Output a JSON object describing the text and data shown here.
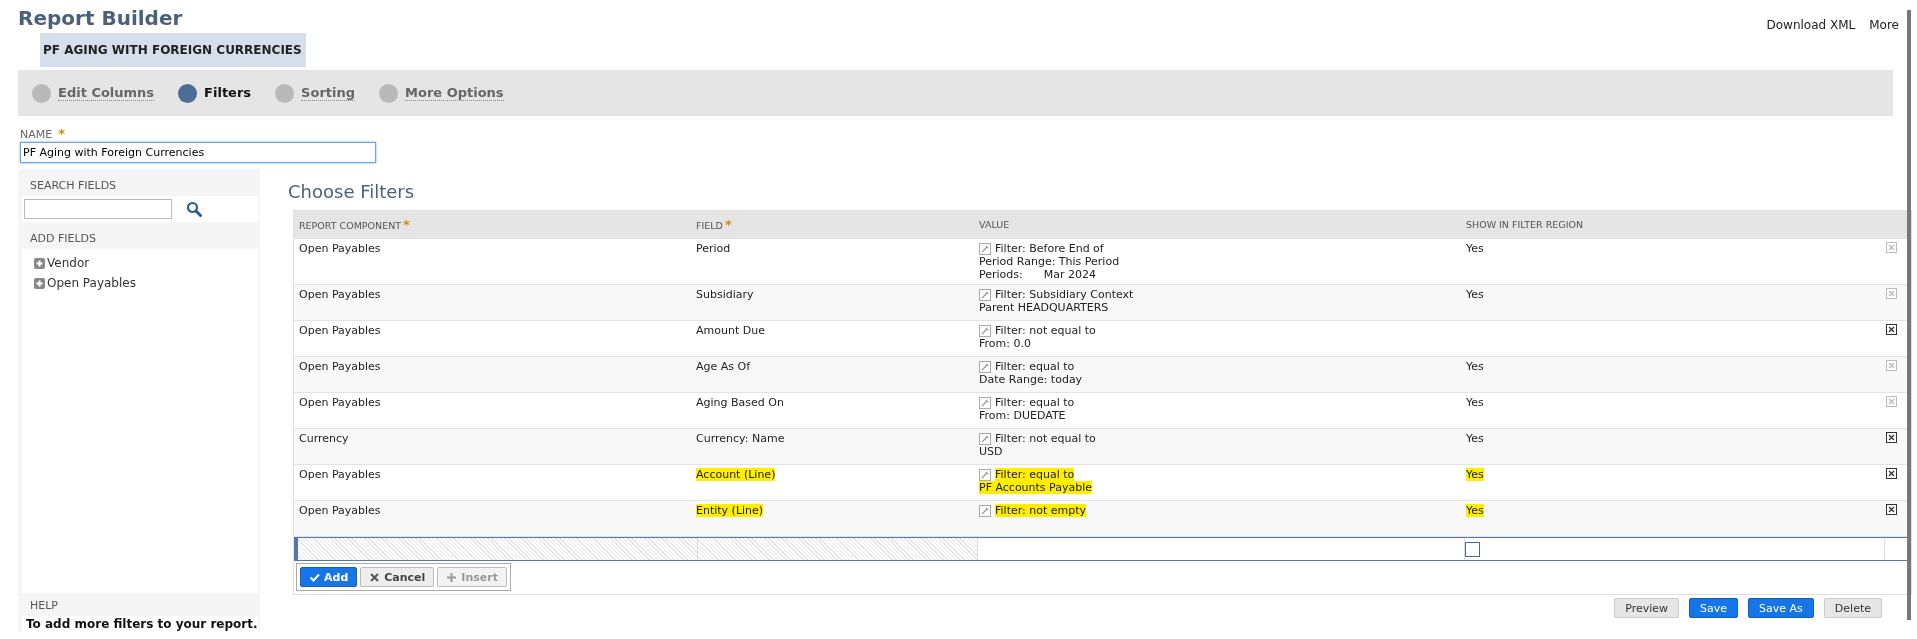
{
  "header": {
    "title": "Report Builder",
    "report_name_badge": "PF AGING WITH FOREIGN CURRENCIES",
    "actions": [
      "Download XML",
      "More"
    ]
  },
  "steps": [
    {
      "label": "Edit Columns",
      "selected": false
    },
    {
      "label": "Filters",
      "selected": true
    },
    {
      "label": "Sorting",
      "selected": false
    },
    {
      "label": "More Options",
      "selected": false
    }
  ],
  "name_field": {
    "label": "NAME",
    "required_mark": "*",
    "value": "PF Aging with Foreign Currencies"
  },
  "sidebar": {
    "search_label": "SEARCH FIELDS",
    "add_label": "ADD FIELDS",
    "items": [
      {
        "label": "Vendor",
        "expanded": false
      },
      {
        "label": "Open Payables",
        "expanded": false
      }
    ],
    "help_label": "HELP",
    "help_text": "To add more filters to your report."
  },
  "filters": {
    "title": "Choose Filters",
    "columns": [
      {
        "label": "REPORT COMPONENT",
        "required": true
      },
      {
        "label": "FIELD",
        "required": true
      },
      {
        "label": "VALUE",
        "required": false
      },
      {
        "label": "SHOW IN FILTER REGION",
        "required": false
      }
    ],
    "rows": [
      {
        "component": "Open Payables",
        "field": "Period",
        "value": [
          "Filter: Before End of",
          "Period Range: This Period",
          "Periods:      Mar 2024"
        ],
        "show": "Yes",
        "remove_enabled": false,
        "highlighted": false
      },
      {
        "component": "Open Payables",
        "field": "Subsidiary",
        "value": [
          "Filter: Subsidiary Context",
          "Parent HEADQUARTERS"
        ],
        "show": "Yes",
        "remove_enabled": false,
        "highlighted": false
      },
      {
        "component": "Open Payables",
        "field": "Amount Due",
        "value": [
          "Filter: not equal to",
          "From: 0.0"
        ],
        "show": "",
        "remove_enabled": true,
        "highlighted": false
      },
      {
        "component": "Open Payables",
        "field": "Age As Of",
        "value": [
          "Filter: equal to",
          "Date Range: today"
        ],
        "show": "Yes",
        "remove_enabled": false,
        "highlighted": false
      },
      {
        "component": "Open Payables",
        "field": "Aging Based On",
        "value": [
          "Filter: equal to",
          "From: DUEDATE"
        ],
        "show": "Yes",
        "remove_enabled": false,
        "highlighted": false
      },
      {
        "component": "Currency",
        "field": "Currency: Name",
        "value": [
          "Filter: not equal to",
          "USD"
        ],
        "show": "Yes",
        "remove_enabled": true,
        "highlighted": false
      },
      {
        "component": "Open Payables",
        "field": "Account (Line)",
        "value": [
          "Filter: equal to",
          "PF Accounts Payable"
        ],
        "show": "Yes",
        "remove_enabled": true,
        "highlighted": true
      },
      {
        "component": "Open Payables",
        "field": "Entity (Line)",
        "value": [
          "Filter: not empty"
        ],
        "show": "Yes",
        "remove_enabled": true,
        "highlighted": true
      }
    ],
    "new_row": {
      "show_checked": false
    },
    "row_buttons": [
      {
        "label": "Add",
        "kind": "primary",
        "disabled": false
      },
      {
        "label": "Cancel",
        "kind": "cancel",
        "disabled": false
      },
      {
        "label": "Insert",
        "kind": "insert",
        "disabled": true
      }
    ]
  },
  "footer_buttons": [
    {
      "label": "Preview",
      "kind": "plain"
    },
    {
      "label": "Save",
      "kind": "primary"
    },
    {
      "label": "Save As",
      "kind": "primary"
    },
    {
      "label": "Delete",
      "kind": "plain"
    }
  ]
}
